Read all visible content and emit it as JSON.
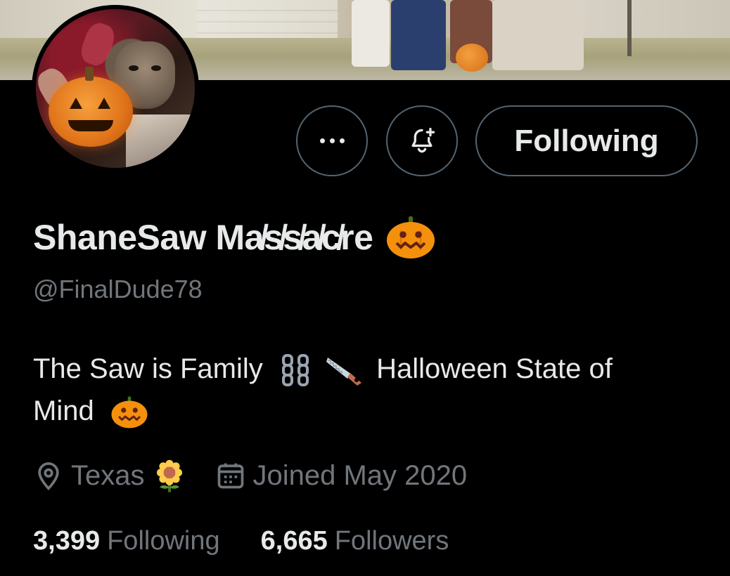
{
  "profile": {
    "display_name": "ShaneSaw Ma̸s̸s̸a̸c̸re",
    "name_emoji": "pumpkin-emoji",
    "handle": "@FinalDude78",
    "bio_line1_text": "The Saw is Family",
    "bio_line1_after": "Halloween State of",
    "bio_line2_text": "Mind",
    "location": "Texas",
    "joined": "Joined May 2020"
  },
  "actions": {
    "more_icon": "more-horizontal-icon",
    "notify_icon": "bell-plus-icon",
    "following_label": "Following"
  },
  "stats": {
    "following_count": "3,399",
    "following_label": "Following",
    "followers_count": "6,665",
    "followers_label": "Followers"
  },
  "colors": {
    "background": "#000000",
    "primary_text": "#e7e9ea",
    "secondary_text": "#71767b",
    "button_border": "#536471",
    "pumpkin": "#f4900c"
  }
}
